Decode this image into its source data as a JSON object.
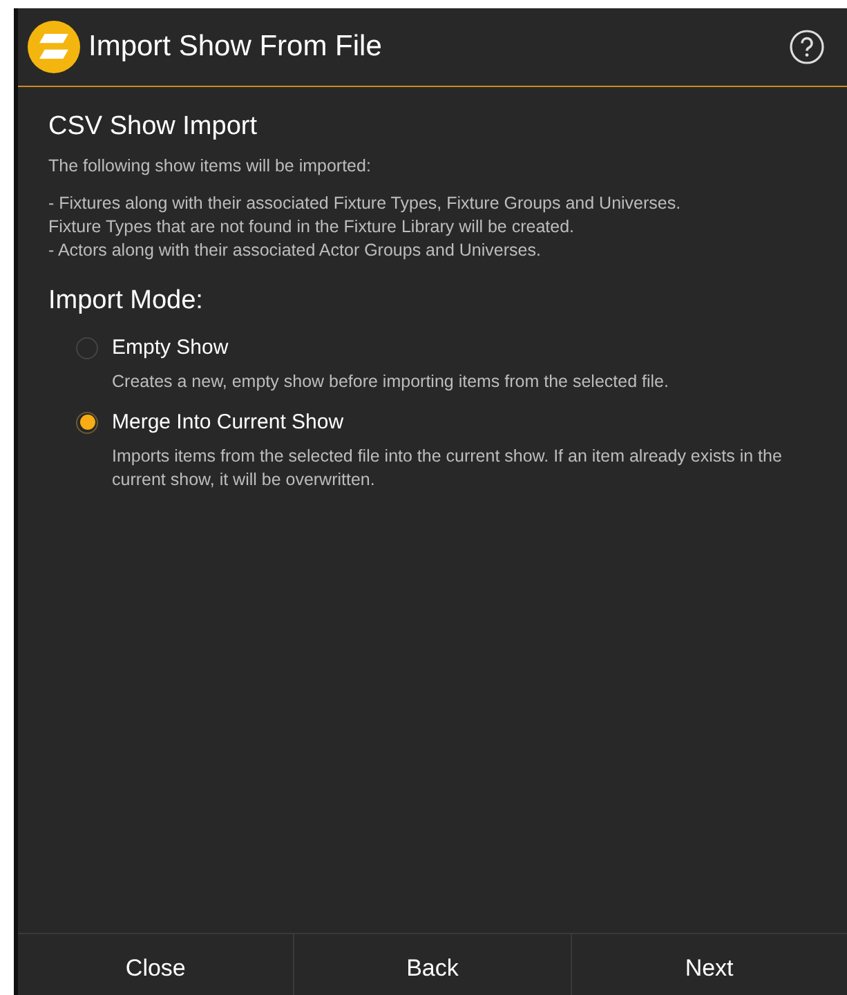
{
  "window": {
    "title": "Import Show From File"
  },
  "section": {
    "title": "CSV Show Import",
    "intro": "The following show items will be imported:",
    "details": [
      "- Fixtures along with their associated Fixture Types, Fixture Groups and Universes.",
      "Fixture Types that are not found in the Fixture Library will be created.",
      "- Actors along with their associated Actor Groups and Universes."
    ]
  },
  "import_mode": {
    "title": "Import Mode:",
    "options": [
      {
        "label": "Empty Show",
        "description": "Creates a new, empty show before importing items from the selected file.",
        "selected": false
      },
      {
        "label": "Merge Into Current Show",
        "description": "Imports items from the selected file into the current show. If an item already exists in the current show, it will be overwritten.",
        "selected": true
      }
    ]
  },
  "buttons": [
    "Close",
    "Back",
    "Next"
  ]
}
